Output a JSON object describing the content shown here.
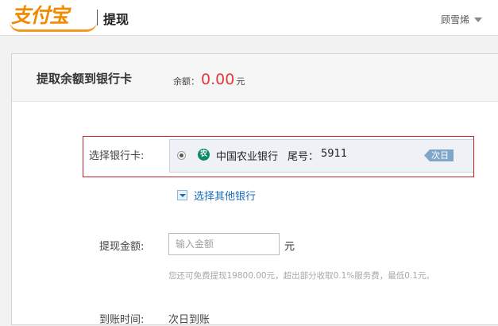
{
  "header": {
    "logo_text": "支付宝",
    "page_title": "提现",
    "user_name": "顾雪烯"
  },
  "main": {
    "title": "提取余额到银行卡",
    "balance_label": "余额：",
    "balance_amount": "0.00",
    "balance_unit": "元"
  },
  "bank_card": {
    "label": "选择银行卡:",
    "bank_icon": "abc-bank-icon",
    "bank_name": "中国农业银行",
    "tail_label": "尾号：",
    "tail_number": "5911",
    "arrive_tag": "次日",
    "selected": true
  },
  "other_bank": {
    "label": "选择其他银行"
  },
  "amount": {
    "label": "提现金额:",
    "placeholder": "输入金额",
    "value": "",
    "unit": "元",
    "hint": "您还可免费提现19800.00元，超出部分收取0.1%服务费，最低0.1元。"
  },
  "arrival": {
    "label": "到账时间:",
    "value": "次日到账"
  },
  "colors": {
    "logo": "#f08a00",
    "amount_red": "#e4393c",
    "link_blue": "#1a6fb8",
    "highlight_border": "#c8242b"
  }
}
